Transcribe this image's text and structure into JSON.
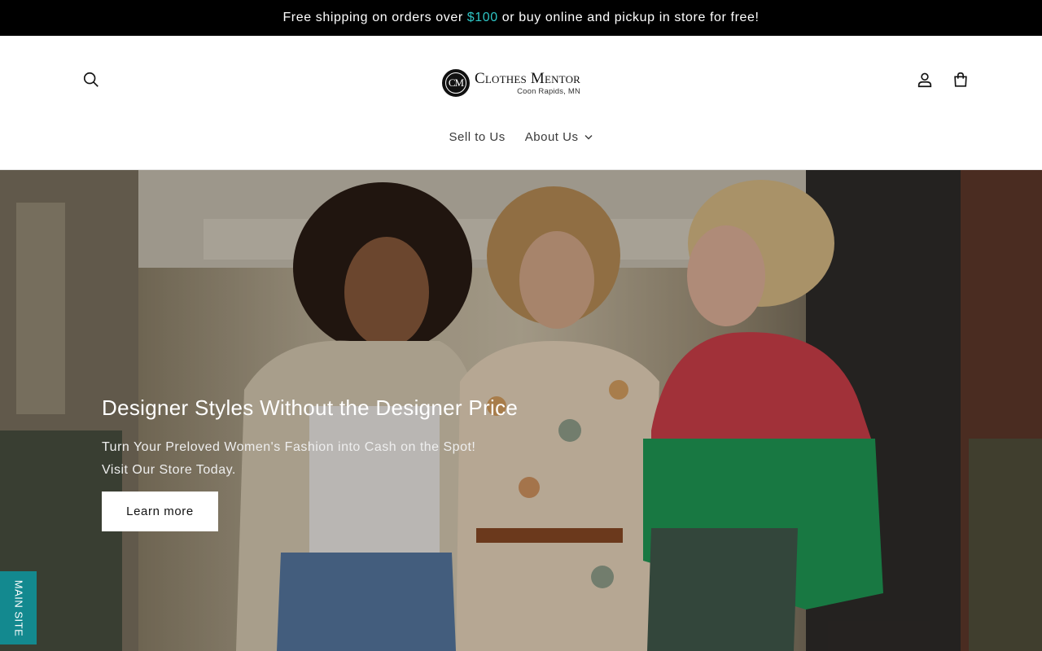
{
  "announcement": {
    "text_before": "Free shipping on orders over",
    "amount": "$100",
    "text_after": "or buy online and pickup in store for free!",
    "amount_color": "#2ec4c4"
  },
  "header": {
    "icons": {
      "search": "search-icon",
      "account": "user-icon",
      "cart": "shopping-bag-icon"
    },
    "logo": {
      "monogram": "CM",
      "name": "Clothes Mentor",
      "location": "Coon Rapids, MN"
    }
  },
  "nav": {
    "items": [
      {
        "label": "Sell to Us",
        "has_dropdown": false
      },
      {
        "label": "About Us",
        "has_dropdown": true
      }
    ]
  },
  "hero": {
    "title": "Designer Styles Without the Designer Price",
    "subtitle_line1": "Turn Your Preloved Women's Fashion into Cash on the Spot!",
    "subtitle_line2": "Visit Our Store Today.",
    "button_label": "Learn more",
    "image_alt": "Three women wearing colorful outfits standing together on a city street"
  },
  "side_tab": {
    "label": "MAIN SITE",
    "color": "#13898f"
  }
}
